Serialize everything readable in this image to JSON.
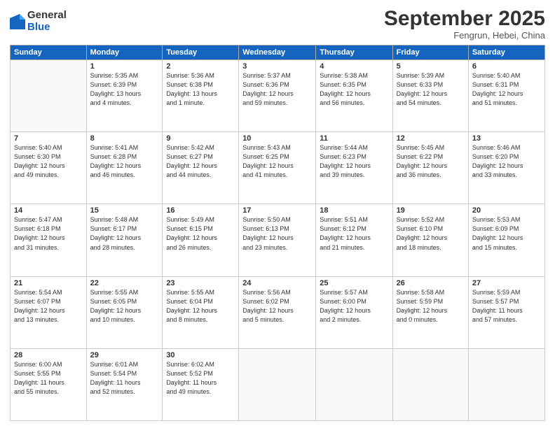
{
  "logo": {
    "general": "General",
    "blue": "Blue"
  },
  "title": "September 2025",
  "subtitle": "Fengrun, Hebei, China",
  "headers": [
    "Sunday",
    "Monday",
    "Tuesday",
    "Wednesday",
    "Thursday",
    "Friday",
    "Saturday"
  ],
  "weeks": [
    [
      {
        "day": "",
        "info": ""
      },
      {
        "day": "1",
        "info": "Sunrise: 5:35 AM\nSunset: 6:39 PM\nDaylight: 13 hours\nand 4 minutes."
      },
      {
        "day": "2",
        "info": "Sunrise: 5:36 AM\nSunset: 6:38 PM\nDaylight: 13 hours\nand 1 minute."
      },
      {
        "day": "3",
        "info": "Sunrise: 5:37 AM\nSunset: 6:36 PM\nDaylight: 12 hours\nand 59 minutes."
      },
      {
        "day": "4",
        "info": "Sunrise: 5:38 AM\nSunset: 6:35 PM\nDaylight: 12 hours\nand 56 minutes."
      },
      {
        "day": "5",
        "info": "Sunrise: 5:39 AM\nSunset: 6:33 PM\nDaylight: 12 hours\nand 54 minutes."
      },
      {
        "day": "6",
        "info": "Sunrise: 5:40 AM\nSunset: 6:31 PM\nDaylight: 12 hours\nand 51 minutes."
      }
    ],
    [
      {
        "day": "7",
        "info": "Sunrise: 5:40 AM\nSunset: 6:30 PM\nDaylight: 12 hours\nand 49 minutes."
      },
      {
        "day": "8",
        "info": "Sunrise: 5:41 AM\nSunset: 6:28 PM\nDaylight: 12 hours\nand 46 minutes."
      },
      {
        "day": "9",
        "info": "Sunrise: 5:42 AM\nSunset: 6:27 PM\nDaylight: 12 hours\nand 44 minutes."
      },
      {
        "day": "10",
        "info": "Sunrise: 5:43 AM\nSunset: 6:25 PM\nDaylight: 12 hours\nand 41 minutes."
      },
      {
        "day": "11",
        "info": "Sunrise: 5:44 AM\nSunset: 6:23 PM\nDaylight: 12 hours\nand 39 minutes."
      },
      {
        "day": "12",
        "info": "Sunrise: 5:45 AM\nSunset: 6:22 PM\nDaylight: 12 hours\nand 36 minutes."
      },
      {
        "day": "13",
        "info": "Sunrise: 5:46 AM\nSunset: 6:20 PM\nDaylight: 12 hours\nand 33 minutes."
      }
    ],
    [
      {
        "day": "14",
        "info": "Sunrise: 5:47 AM\nSunset: 6:18 PM\nDaylight: 12 hours\nand 31 minutes."
      },
      {
        "day": "15",
        "info": "Sunrise: 5:48 AM\nSunset: 6:17 PM\nDaylight: 12 hours\nand 28 minutes."
      },
      {
        "day": "16",
        "info": "Sunrise: 5:49 AM\nSunset: 6:15 PM\nDaylight: 12 hours\nand 26 minutes."
      },
      {
        "day": "17",
        "info": "Sunrise: 5:50 AM\nSunset: 6:13 PM\nDaylight: 12 hours\nand 23 minutes."
      },
      {
        "day": "18",
        "info": "Sunrise: 5:51 AM\nSunset: 6:12 PM\nDaylight: 12 hours\nand 21 minutes."
      },
      {
        "day": "19",
        "info": "Sunrise: 5:52 AM\nSunset: 6:10 PM\nDaylight: 12 hours\nand 18 minutes."
      },
      {
        "day": "20",
        "info": "Sunrise: 5:53 AM\nSunset: 6:09 PM\nDaylight: 12 hours\nand 15 minutes."
      }
    ],
    [
      {
        "day": "21",
        "info": "Sunrise: 5:54 AM\nSunset: 6:07 PM\nDaylight: 12 hours\nand 13 minutes."
      },
      {
        "day": "22",
        "info": "Sunrise: 5:55 AM\nSunset: 6:05 PM\nDaylight: 12 hours\nand 10 minutes."
      },
      {
        "day": "23",
        "info": "Sunrise: 5:55 AM\nSunset: 6:04 PM\nDaylight: 12 hours\nand 8 minutes."
      },
      {
        "day": "24",
        "info": "Sunrise: 5:56 AM\nSunset: 6:02 PM\nDaylight: 12 hours\nand 5 minutes."
      },
      {
        "day": "25",
        "info": "Sunrise: 5:57 AM\nSunset: 6:00 PM\nDaylight: 12 hours\nand 2 minutes."
      },
      {
        "day": "26",
        "info": "Sunrise: 5:58 AM\nSunset: 5:59 PM\nDaylight: 12 hours\nand 0 minutes."
      },
      {
        "day": "27",
        "info": "Sunrise: 5:59 AM\nSunset: 5:57 PM\nDaylight: 11 hours\nand 57 minutes."
      }
    ],
    [
      {
        "day": "28",
        "info": "Sunrise: 6:00 AM\nSunset: 5:55 PM\nDaylight: 11 hours\nand 55 minutes."
      },
      {
        "day": "29",
        "info": "Sunrise: 6:01 AM\nSunset: 5:54 PM\nDaylight: 11 hours\nand 52 minutes."
      },
      {
        "day": "30",
        "info": "Sunrise: 6:02 AM\nSunset: 5:52 PM\nDaylight: 11 hours\nand 49 minutes."
      },
      {
        "day": "",
        "info": ""
      },
      {
        "day": "",
        "info": ""
      },
      {
        "day": "",
        "info": ""
      },
      {
        "day": "",
        "info": ""
      }
    ]
  ]
}
